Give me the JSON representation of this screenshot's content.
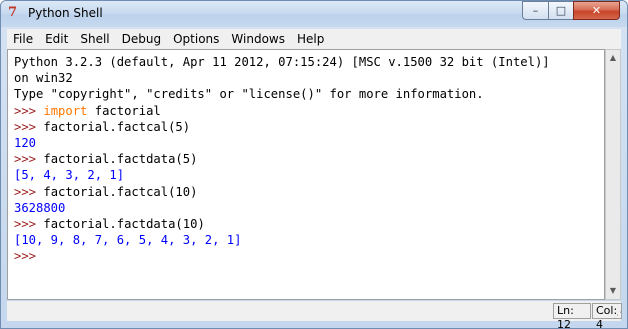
{
  "window": {
    "title": "Python Shell",
    "icon": "python-idle-icon",
    "controls": {
      "minimize": "–",
      "maximize": "□",
      "close": "✕"
    }
  },
  "menubar": {
    "items": [
      "File",
      "Edit",
      "Shell",
      "Debug",
      "Options",
      "Windows",
      "Help"
    ]
  },
  "shell": {
    "lines": [
      {
        "parts": [
          {
            "t": "Python 3.2.3 (default, Apr 11 2012, 07:15:24) [MSC v.1500 32 bit (Intel)]",
            "c": "text"
          }
        ]
      },
      {
        "parts": [
          {
            "t": "on win32",
            "c": "text"
          }
        ]
      },
      {
        "parts": [
          {
            "t": "Type \"copyright\", \"credits\" or \"license()\" for more information.",
            "c": "text"
          }
        ]
      },
      {
        "parts": [
          {
            "t": ">>> ",
            "c": "prompt"
          },
          {
            "t": "import",
            "c": "kw"
          },
          {
            "t": " factorial",
            "c": "text"
          }
        ]
      },
      {
        "parts": [
          {
            "t": ">>> ",
            "c": "prompt"
          },
          {
            "t": "factorial.factcal(5)",
            "c": "text"
          }
        ]
      },
      {
        "parts": [
          {
            "t": "120",
            "c": "out"
          }
        ]
      },
      {
        "parts": [
          {
            "t": ">>> ",
            "c": "prompt"
          },
          {
            "t": "factorial.factdata(5)",
            "c": "text"
          }
        ]
      },
      {
        "parts": [
          {
            "t": "[5, 4, 3, 2, 1]",
            "c": "out"
          }
        ]
      },
      {
        "parts": [
          {
            "t": ">>> ",
            "c": "prompt"
          },
          {
            "t": "factorial.factcal(10)",
            "c": "text"
          }
        ]
      },
      {
        "parts": [
          {
            "t": "3628800",
            "c": "out"
          }
        ]
      },
      {
        "parts": [
          {
            "t": ">>> ",
            "c": "prompt"
          },
          {
            "t": "factorial.factdata(10)",
            "c": "text"
          }
        ]
      },
      {
        "parts": [
          {
            "t": "[10, 9, 8, 7, 6, 5, 4, 3, 2, 1]",
            "c": "out"
          }
        ]
      },
      {
        "parts": [
          {
            "t": ">>> ",
            "c": "prompt"
          }
        ]
      }
    ]
  },
  "status": {
    "line": "Ln: 12",
    "col": "Col: 4"
  },
  "colors": {
    "prompt": "#9b1c1c",
    "keyword": "#ff7700",
    "output": "#0000ff",
    "text": "#000000"
  }
}
